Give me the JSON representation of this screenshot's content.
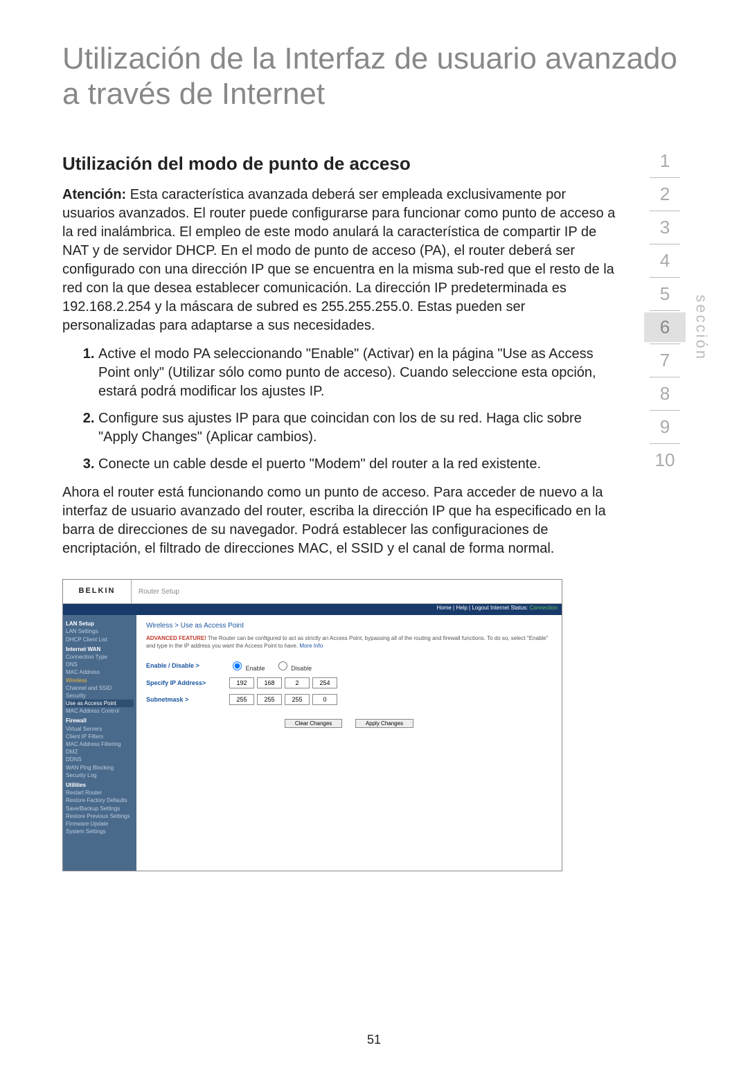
{
  "page_number": "51",
  "main_title": "Utilización de la Interfaz de usuario avanzado a través de Internet",
  "subheading": "Utilización del modo de punto de acceso",
  "attention_label": "Atención:",
  "attention_text": "Esta característica avanzada deberá ser empleada exclusivamente por usuarios avanzados. El router puede configurarse para funcionar como punto de acceso a la red inalámbrica. El empleo de este modo anulará la característica de compartir IP de NAT y de servidor DHCP. En el modo de punto de acceso (PA), el router deberá ser configurado con una dirección IP que se encuentra en la misma sub-red que el resto de la red con la que desea establecer comunicación. La dirección IP predeterminada es 192.168.2.254 y la máscara de subred es 255.255.255.0. Estas pueden ser personalizadas para adaptarse a sus necesidades.",
  "steps": [
    "Active el modo PA seleccionando \"Enable\" (Activar) en la página \"Use as Access Point only\" (Utilizar sólo como punto de acceso). Cuando seleccione esta opción, estará podrá modificar los ajustes IP.",
    "Configure sus ajustes IP para que coincidan con los de su red. Haga clic sobre \"Apply Changes\" (Aplicar cambios).",
    "Conecte un cable desde el puerto \"Modem\" del router a la red existente."
  ],
  "closing": "Ahora el router está funcionando como un punto de acceso. Para acceder de nuevo a la interfaz de usuario avanzado del router, escriba la dirección IP que ha especificado en la barra de direcciones de su navegador. Podrá establecer las configuraciones de encriptación, el filtrado de direcciones MAC, el SSID y el canal de forma normal.",
  "section_label": "sección",
  "section_numbers": [
    "1",
    "2",
    "3",
    "4",
    "5",
    "6",
    "7",
    "8",
    "9",
    "10"
  ],
  "section_active_index": 5,
  "router": {
    "logo": "BELKIN",
    "tab": "Router Setup",
    "status_links": "Home | Help | Logout   Internet Status:",
    "status_conn": "Connection",
    "sidebar": [
      {
        "t": "LAN Setup",
        "c": "hdr"
      },
      {
        "t": "LAN Settings",
        "c": ""
      },
      {
        "t": "DHCP Client List",
        "c": ""
      },
      {
        "t": "Internet WAN",
        "c": "hdr"
      },
      {
        "t": "Connection Type",
        "c": ""
      },
      {
        "t": "DNS",
        "c": ""
      },
      {
        "t": "MAC Address",
        "c": ""
      },
      {
        "t": "Wireless",
        "c": "sel"
      },
      {
        "t": "Channel and SSID",
        "c": ""
      },
      {
        "t": "Security",
        "c": ""
      },
      {
        "t": "Use as Access Point",
        "c": "hl"
      },
      {
        "t": "MAC Address Control",
        "c": ""
      },
      {
        "t": "Firewall",
        "c": "hdr"
      },
      {
        "t": "Virtual Servers",
        "c": ""
      },
      {
        "t": "Client IP Filters",
        "c": ""
      },
      {
        "t": "MAC Address Filtering",
        "c": ""
      },
      {
        "t": "DMZ",
        "c": ""
      },
      {
        "t": "DDNS",
        "c": ""
      },
      {
        "t": "WAN Ping Blocking",
        "c": ""
      },
      {
        "t": "Security Log",
        "c": ""
      },
      {
        "t": "Utilities",
        "c": "hdr"
      },
      {
        "t": "Restart Router",
        "c": ""
      },
      {
        "t": "Restore Factory Defaults",
        "c": ""
      },
      {
        "t": "Save/Backup Settings",
        "c": ""
      },
      {
        "t": "Restore Previous Settings",
        "c": ""
      },
      {
        "t": "Firmware Update",
        "c": ""
      },
      {
        "t": "System Settings",
        "c": ""
      }
    ],
    "crumb": "Wireless > Use as Access Point",
    "adv_label": "ADVANCED FEATURE!",
    "adv_text": "The Router can be configured to act as strictly an Access Point, bypassing all of the routing and firewall functions. To do so, select \"Enable\" and type in the IP address you want the Access Point to have.",
    "adv_more": "More Info",
    "row_enable_lbl": "Enable / Disable >",
    "enable": "Enable",
    "disable": "Disable",
    "row_ip_lbl": "Specify IP Address>",
    "ip": [
      "192",
      "168",
      "2",
      "254"
    ],
    "row_mask_lbl": "Subnetmask >",
    "mask": [
      "255",
      "255",
      "255",
      "0"
    ],
    "btn_clear": "Clear Changes",
    "btn_apply": "Apply Changes"
  }
}
